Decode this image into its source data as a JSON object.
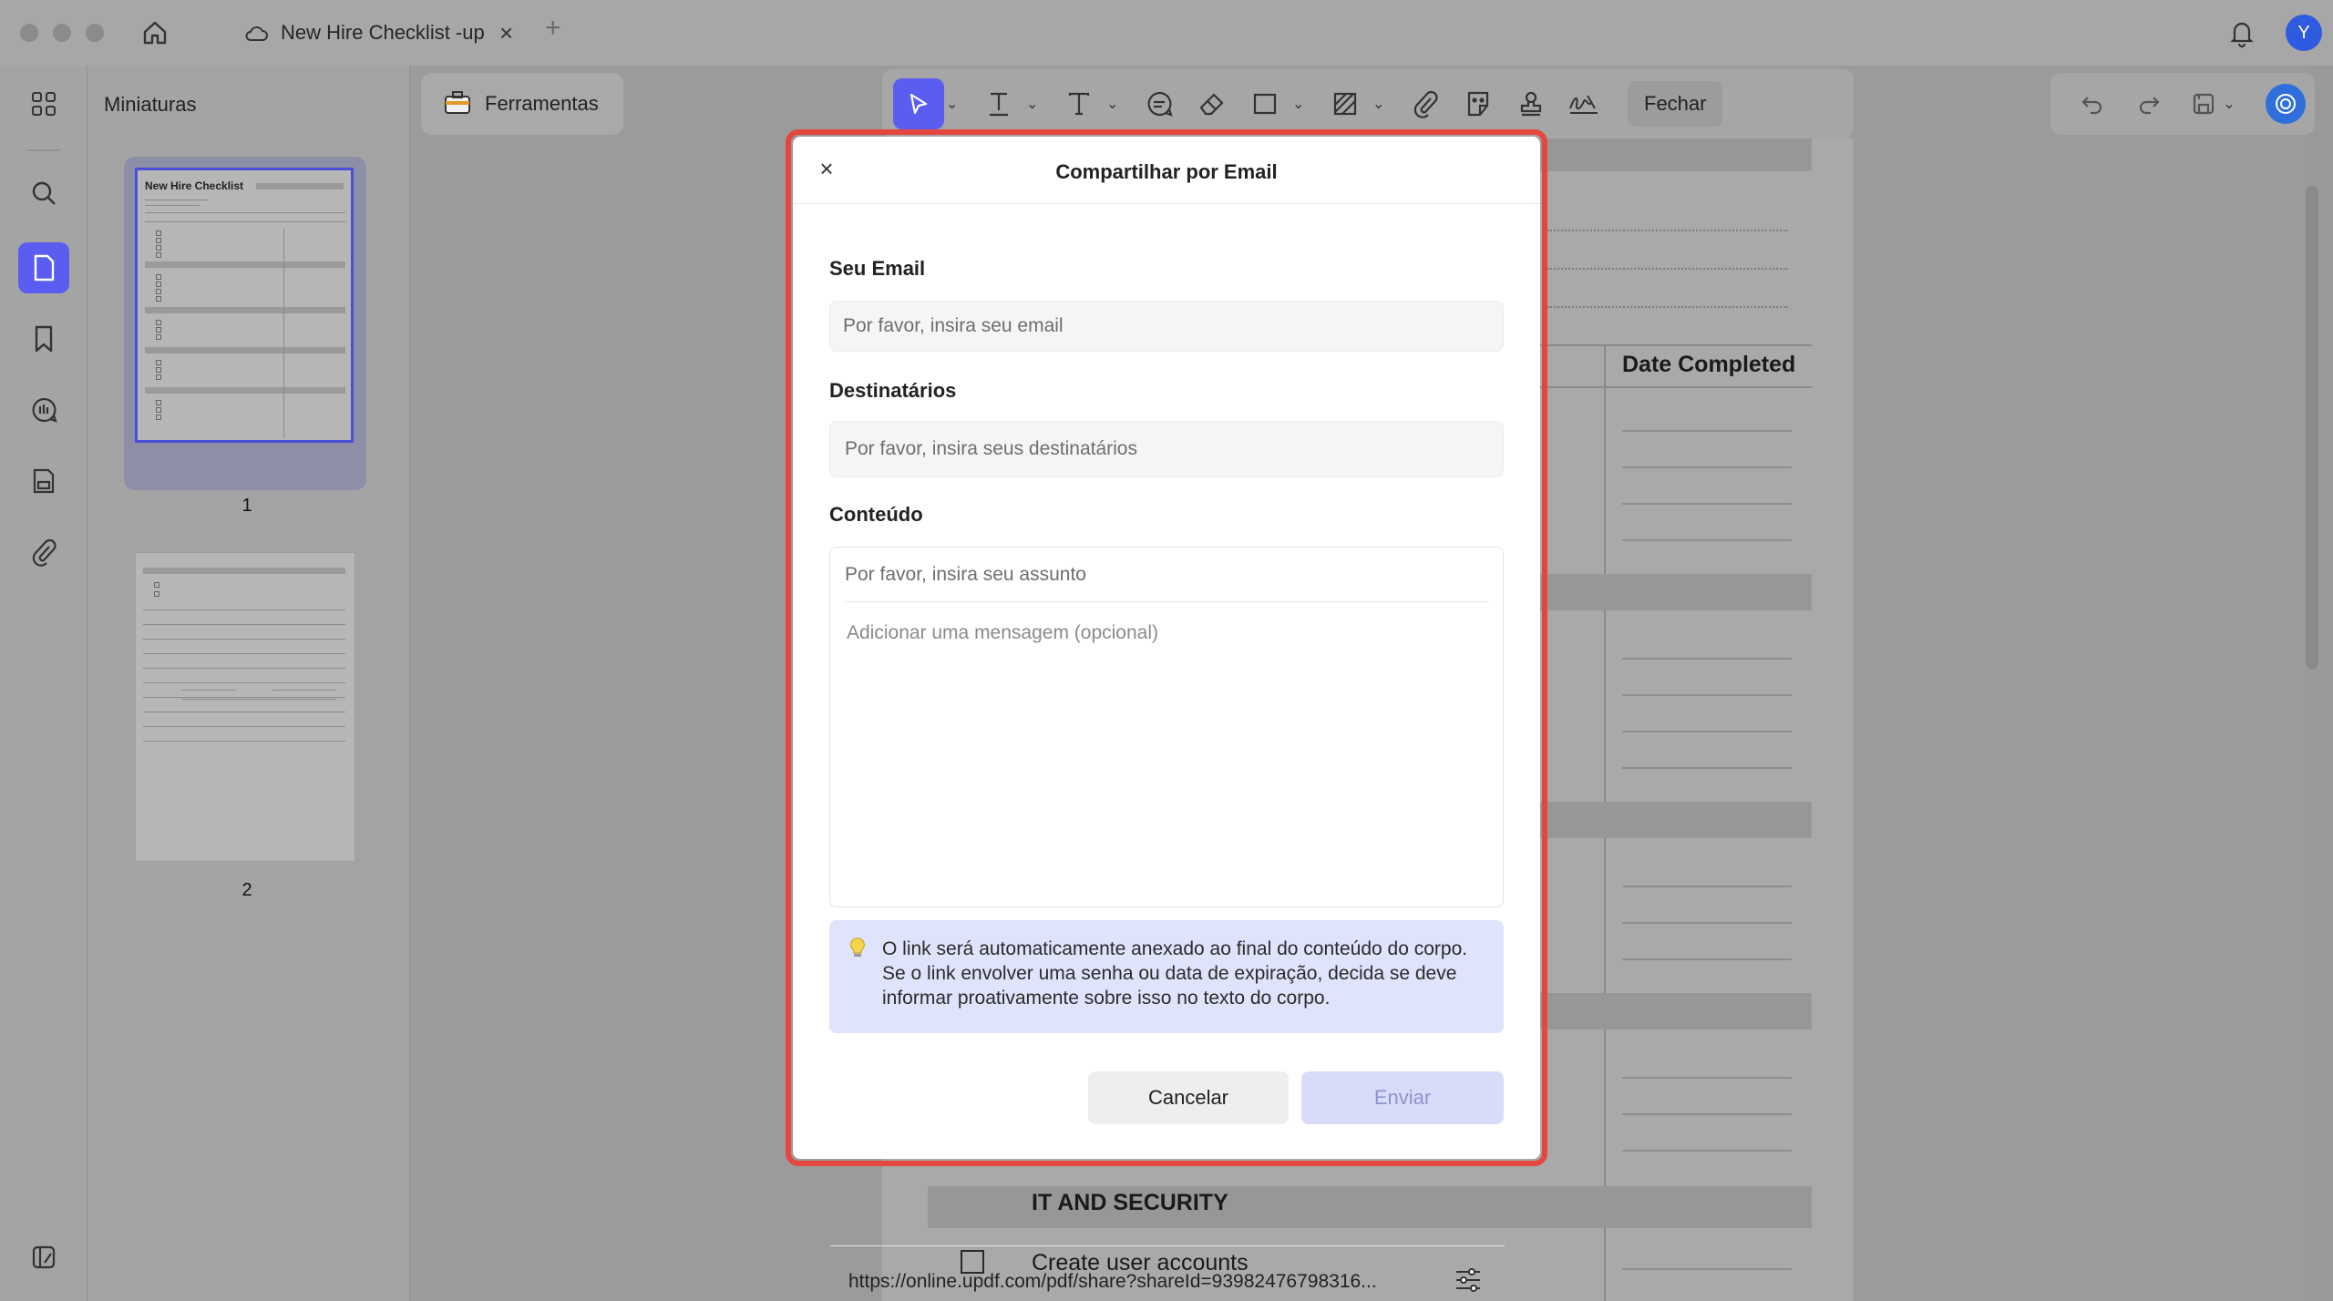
{
  "window": {
    "tab_title": "New Hire Checklist -up",
    "tab_close": "×",
    "new_tab": "+",
    "avatar_initial": "Y"
  },
  "sidebar": {
    "thumbnails_title": "Miniaturas",
    "pages": [
      {
        "number": "1",
        "title": "New Hire Checklist"
      },
      {
        "number": "2"
      }
    ]
  },
  "toolbar": {
    "tools_label": "Ferramentas",
    "close_label": "Fechar"
  },
  "document": {
    "date_completed": "Date Completed",
    "section_it": "IT AND SECURITY",
    "item_create_accounts": "Create user accounts"
  },
  "dialog": {
    "title": "Compartilhar por Email",
    "close": "×",
    "your_email_label": "Seu Email",
    "your_email_placeholder": "Por favor, insira seu email",
    "recipients_label": "Destinatários",
    "recipients_placeholder": "Por favor, insira seus destinatários",
    "content_label": "Conteúdo",
    "subject_placeholder": "Por favor, insira seu assunto",
    "message_placeholder": "Adicionar uma mensagem (opcional)",
    "share_link": "https://online.updf.com/pdf/share?shareId=93982476798316...",
    "info_icon": "lightbulb-icon",
    "info_text": "O link será automaticamente anexado ao final do conteúdo do corpo. Se o link envolver uma senha ou data de expiração, decida se deve informar proativamente sobre isso no texto do corpo.",
    "cancel_label": "Cancelar",
    "send_label": "Enviar"
  },
  "colors": {
    "accent": "#5b5cf0",
    "highlight_border": "#e4473f",
    "info_background": "#dfe3fb"
  }
}
